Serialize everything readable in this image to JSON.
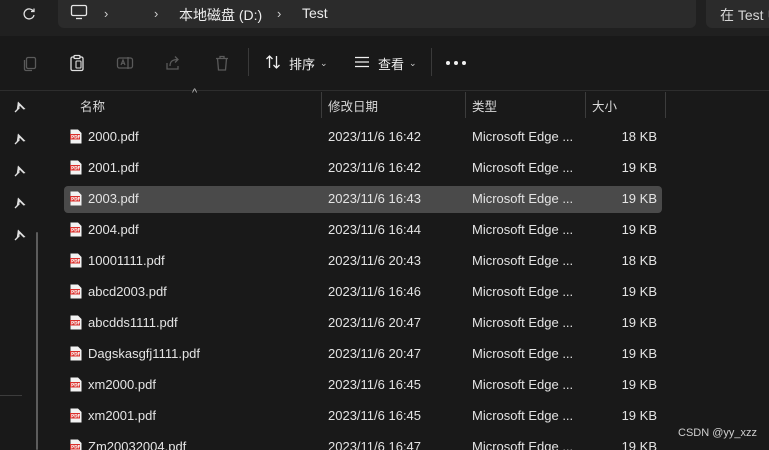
{
  "address_bar": {
    "crumbs": [
      "本地磁盘 (D:)",
      "Test"
    ],
    "search_placeholder": "在 Test 中"
  },
  "toolbar": {
    "sort_label": "排序",
    "view_label": "查看"
  },
  "columns": {
    "name": "名称",
    "modified": "修改日期",
    "type": "类型",
    "size": "大小"
  },
  "files": [
    {
      "name": "2000.pdf",
      "modified": "2023/11/6 16:42",
      "type": "Microsoft Edge ...",
      "size": "18 KB",
      "selected": false
    },
    {
      "name": "2001.pdf",
      "modified": "2023/11/6 16:42",
      "type": "Microsoft Edge ...",
      "size": "19 KB",
      "selected": false
    },
    {
      "name": "2003.pdf",
      "modified": "2023/11/6 16:43",
      "type": "Microsoft Edge ...",
      "size": "19 KB",
      "selected": true
    },
    {
      "name": "2004.pdf",
      "modified": "2023/11/6 16:44",
      "type": "Microsoft Edge ...",
      "size": "19 KB",
      "selected": false
    },
    {
      "name": "10001111.pdf",
      "modified": "2023/11/6 20:43",
      "type": "Microsoft Edge ...",
      "size": "18 KB",
      "selected": false
    },
    {
      "name": "abcd2003.pdf",
      "modified": "2023/11/6 16:46",
      "type": "Microsoft Edge ...",
      "size": "19 KB",
      "selected": false
    },
    {
      "name": "abcdds1111.pdf",
      "modified": "2023/11/6 20:47",
      "type": "Microsoft Edge ...",
      "size": "19 KB",
      "selected": false
    },
    {
      "name": "Dagskasgfj1111.pdf",
      "modified": "2023/11/6 20:47",
      "type": "Microsoft Edge ...",
      "size": "19 KB",
      "selected": false
    },
    {
      "name": "xm2000.pdf",
      "modified": "2023/11/6 16:45",
      "type": "Microsoft Edge ...",
      "size": "19 KB",
      "selected": false
    },
    {
      "name": "xm2001.pdf",
      "modified": "2023/11/6 16:45",
      "type": "Microsoft Edge ...",
      "size": "19 KB",
      "selected": false
    },
    {
      "name": "Zm20032004.pdf",
      "modified": "2023/11/6 16:47",
      "type": "Microsoft Edge ...",
      "size": "19 KB",
      "selected": false
    }
  ],
  "watermark": "CSDN @yy_xzz",
  "colors": {
    "background": "#191919",
    "selected_row": "#4a4a4a",
    "pdf_icon": "#d9302c"
  }
}
